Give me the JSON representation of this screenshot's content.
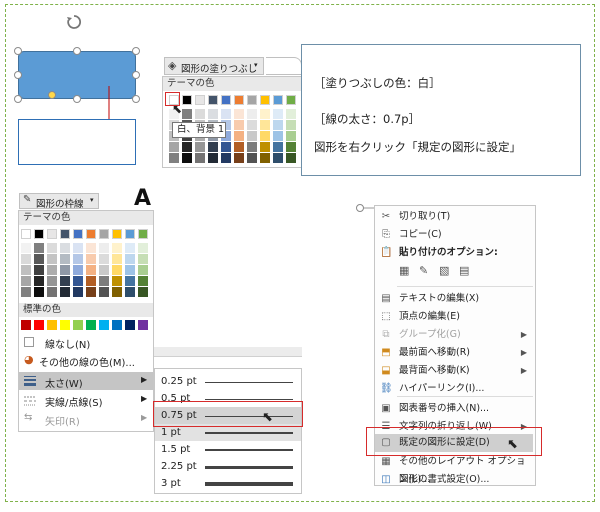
{
  "info_box": {
    "line1": "［塗りつぶしの色：白］",
    "line2": "［線の太さ：0.7p］",
    "line3": "図形を右クリック「規定の図形に設定」"
  },
  "fill_panel": {
    "button_label": "図形の塗りつぶし",
    "section_theme": "テーマの色",
    "tooltip": "白、背景 1"
  },
  "outline_panel": {
    "button_label": "図形の枠線",
    "section_theme": "テーマの色",
    "section_standard": "標準の色",
    "no_line": "線なし(N)",
    "other_colors": "その他の線の色(M)...",
    "weight": "太さ(W)",
    "dash": "実線/点線(S)",
    "arrow": "矢印(R)",
    "big_a": "A"
  },
  "thickness_menu": {
    "items": [
      "0.25 pt",
      "0.5 pt",
      "0.75 pt",
      "1 pt",
      "1.5 pt",
      "2.25 pt",
      "3 pt"
    ]
  },
  "context_menu": {
    "items": [
      {
        "label": "切り取り(T)",
        "icon": "cut-icon"
      },
      {
        "label": "コピー(C)",
        "icon": "copy-icon"
      },
      {
        "label": "貼り付けのオプション:",
        "icon": "paste-icon"
      },
      {
        "label": "テキストの編集(X)",
        "icon": "edit-text-icon"
      },
      {
        "label": "頂点の編集(E)",
        "icon": "edit-points-icon"
      },
      {
        "label": "グループ化(G)",
        "icon": "group-icon"
      },
      {
        "label": "最前面へ移動(R)",
        "icon": "bring-front-icon"
      },
      {
        "label": "最背面へ移動(K)",
        "icon": "send-back-icon"
      },
      {
        "label": "ハイパーリンク(I)...",
        "icon": "hyperlink-icon"
      },
      {
        "label": "図表番号の挿入(N)...",
        "icon": "caption-icon"
      },
      {
        "label": "文字列の折り返し(W)",
        "icon": "wrap-icon"
      },
      {
        "label": "既定の図形に設定(D)",
        "icon": "default-shape-icon"
      },
      {
        "label": "その他のレイアウト オプション(L)...",
        "icon": "layout-icon"
      },
      {
        "label": "図形の書式設定(O)...",
        "icon": "format-shape-icon"
      }
    ]
  },
  "colors": {
    "theme_top": [
      "#ffffff",
      "#000000",
      "#e7e6e6",
      "#44546a",
      "#4472c4",
      "#ed7d31",
      "#a5a5a5",
      "#ffc000",
      "#5b9bd5",
      "#70ad47"
    ],
    "standard": [
      "#c00000",
      "#ff0000",
      "#ffc000",
      "#ffff00",
      "#92d050",
      "#00b050",
      "#00b0f0",
      "#0070c0",
      "#002060",
      "#7030a0"
    ],
    "shape_fill": "#5b9bd5",
    "highlight_red": "#d62b2b"
  }
}
